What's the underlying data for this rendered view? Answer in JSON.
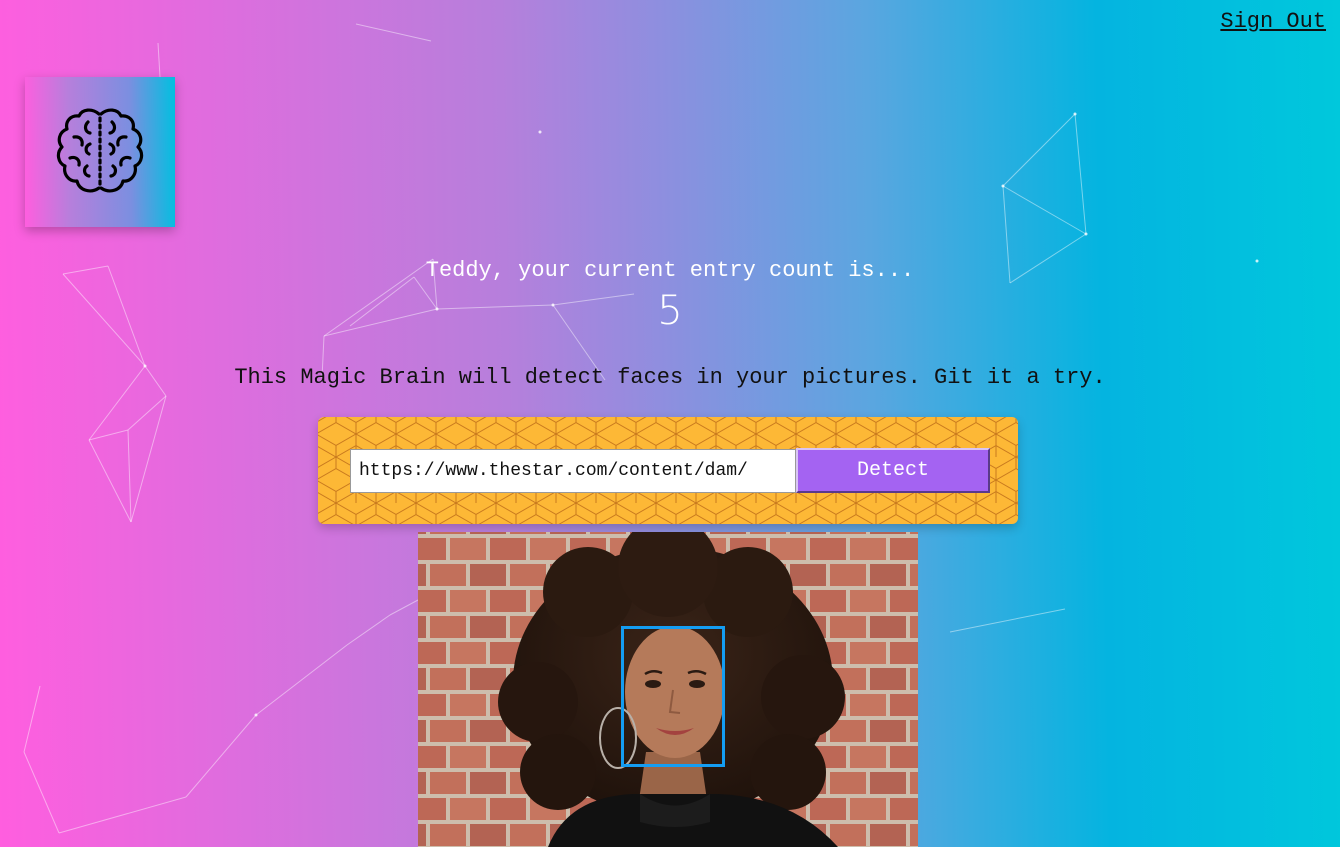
{
  "nav": {
    "sign_out": "Sign Out"
  },
  "logo": {
    "icon": "brain-icon"
  },
  "rank": {
    "message": "Teddy, your current entry count is...",
    "count": "5"
  },
  "intro": {
    "text": "This Magic Brain will detect faces in your pictures. Git it a try."
  },
  "form": {
    "url_value": "https://www.thestar.com/content/dam/",
    "detect_label": "Detect"
  },
  "result": {
    "image": "portrait-photo",
    "face_box": "face-bounding-box"
  },
  "colors": {
    "accent": "#a463f2",
    "form_bg": "#fdb836",
    "face_box": "#149df2",
    "gradient_start": "#ff5edf",
    "gradient_end": "#00c8dc"
  }
}
